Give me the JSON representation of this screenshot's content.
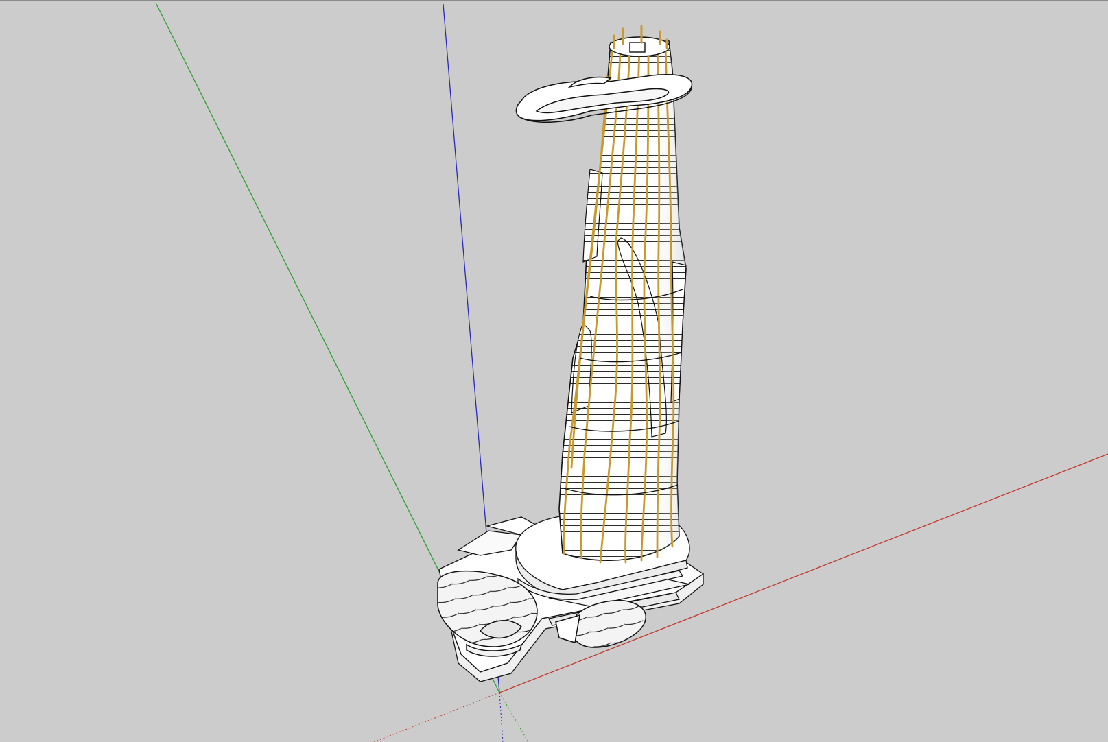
{
  "viewport": {
    "label": "",
    "background": "#cccccc",
    "edge_color": "#000000",
    "face_color": "#ffffff",
    "rib_color": "#c89a2e"
  },
  "axes": {
    "red": {
      "color": "#c0392b",
      "visible": true
    },
    "green": {
      "color": "#2e9e2e",
      "visible": true
    },
    "blue": {
      "color": "#2a2ab8",
      "visible": true
    }
  },
  "model": {
    "components": [
      "tower",
      "crown-ring",
      "podium",
      "dome-pavilion-left",
      "dome-pavilion-right"
    ]
  }
}
